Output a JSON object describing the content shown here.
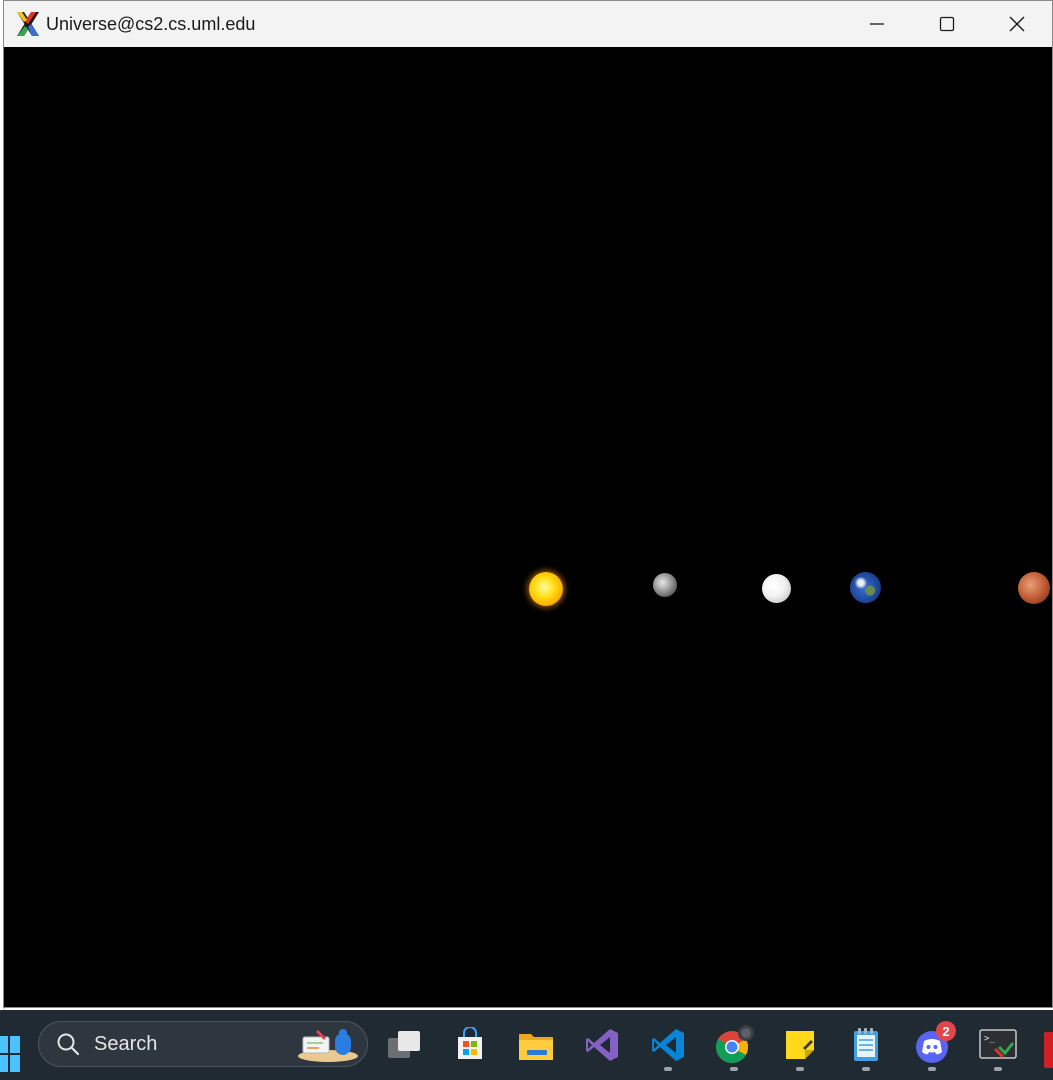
{
  "window": {
    "title": "Universe@cs2.cs.uml.edu"
  },
  "simulation": {
    "bodies": [
      "sun",
      "mercury",
      "venus",
      "earth",
      "mars"
    ]
  },
  "taskbar": {
    "search_placeholder": "Search",
    "apps": [
      {
        "name": "task-view",
        "icon": "task-view-icon"
      },
      {
        "name": "microsoft-store",
        "icon": "store-icon"
      },
      {
        "name": "file-explorer",
        "icon": "folder-icon"
      },
      {
        "name": "visual-studio",
        "icon": "visual-studio-icon"
      },
      {
        "name": "vs-code",
        "icon": "vscode-icon"
      },
      {
        "name": "chrome",
        "icon": "chrome-icon"
      },
      {
        "name": "sticky-notes",
        "icon": "sticky-notes-icon"
      },
      {
        "name": "notepad",
        "icon": "notepad-icon"
      },
      {
        "name": "discord",
        "icon": "discord-icon",
        "badge": "2"
      },
      {
        "name": "xlaunch",
        "icon": "terminal-icon"
      }
    ]
  },
  "colors": {
    "taskbar_bg": "#202a33",
    "titlebar_bg": "#f3f3f3",
    "canvas_bg": "#000000"
  }
}
